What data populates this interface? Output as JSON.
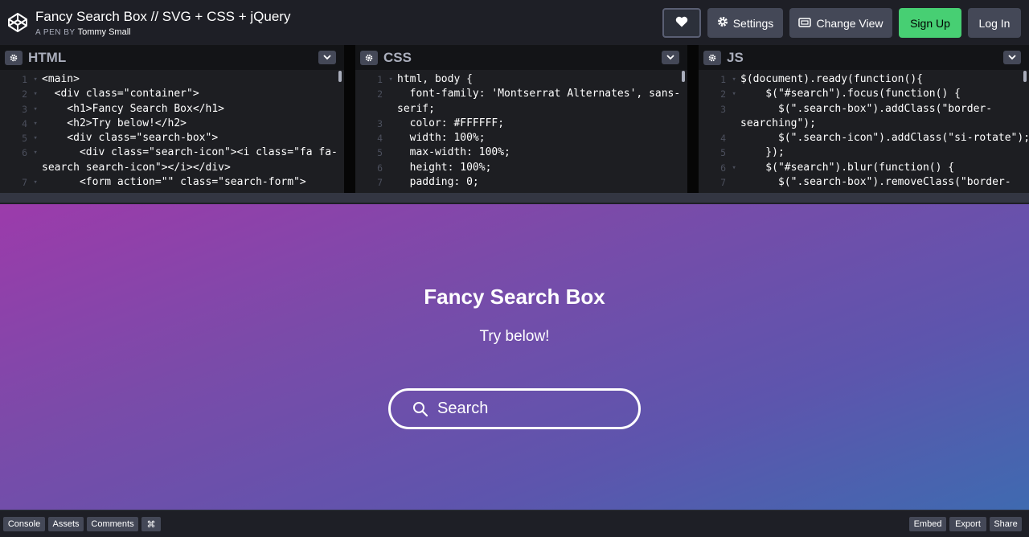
{
  "header": {
    "title": "Fancy Search Box // SVG + CSS + jQuery",
    "by_prefix": "A PEN BY",
    "author": "Tommy Small",
    "buttons": {
      "settings": "Settings",
      "change_view": "Change View",
      "sign_up": "Sign Up",
      "log_in": "Log In"
    }
  },
  "editors": {
    "html": {
      "name": "HTML",
      "lines": [
        {
          "n": "1",
          "fold": "▾",
          "text": "<main>"
        },
        {
          "n": "2",
          "fold": "▾",
          "text": "  <div class=\"container\">"
        },
        {
          "n": "3",
          "fold": "▾",
          "text": "    <h1>Fancy Search Box</h1>"
        },
        {
          "n": "4",
          "fold": "▾",
          "text": "    <h2>Try below!</h2>"
        },
        {
          "n": "5",
          "fold": "▾",
          "text": "    <div class=\"search-box\">"
        },
        {
          "n": "6",
          "fold": "▾",
          "text": "      <div class=\"search-icon\"><i class=\"fa fa-"
        },
        {
          "n": "",
          "fold": "",
          "text": "search search-icon\"></i></div>"
        },
        {
          "n": "7",
          "fold": "▾",
          "text": "      <form action=\"\" class=\"search-form\">"
        }
      ]
    },
    "css": {
      "name": "CSS",
      "lines": [
        {
          "n": "1",
          "fold": "▾",
          "text": "html, body {"
        },
        {
          "n": "2",
          "fold": "",
          "text": "  font-family: 'Montserrat Alternates', sans-"
        },
        {
          "n": "",
          "fold": "",
          "text": "serif;"
        },
        {
          "n": "3",
          "fold": "",
          "text": "  color: #FFFFFF;"
        },
        {
          "n": "4",
          "fold": "",
          "text": "  width: 100%;"
        },
        {
          "n": "5",
          "fold": "",
          "text": "  max-width: 100%;"
        },
        {
          "n": "6",
          "fold": "",
          "text": "  height: 100%;"
        },
        {
          "n": "7",
          "fold": "",
          "text": "  padding: 0;"
        }
      ]
    },
    "js": {
      "name": "JS",
      "lines": [
        {
          "n": "1",
          "fold": "▾",
          "text": "$(document).ready(function(){"
        },
        {
          "n": "2",
          "fold": "▾",
          "text": "    $(\"#search\").focus(function() {"
        },
        {
          "n": "3",
          "fold": "",
          "text": "      $(\".search-box\").addClass(\"border-"
        },
        {
          "n": "",
          "fold": "",
          "text": "searching\");"
        },
        {
          "n": "4",
          "fold": "",
          "text": "      $(\".search-icon\").addClass(\"si-rotate\");"
        },
        {
          "n": "5",
          "fold": "",
          "text": "    });"
        },
        {
          "n": "6",
          "fold": "▾",
          "text": "    $(\"#search\").blur(function() {"
        },
        {
          "n": "7",
          "fold": "",
          "text": "      $(\".search-box\").removeClass(\"border-"
        }
      ]
    }
  },
  "preview": {
    "title": "Fancy Search Box",
    "subtitle": "Try below!",
    "search_placeholder": "Search"
  },
  "footer": {
    "left": [
      "Console",
      "Assets",
      "Comments",
      "⌘"
    ],
    "right": [
      "Embed",
      "Export",
      "Share"
    ]
  }
}
